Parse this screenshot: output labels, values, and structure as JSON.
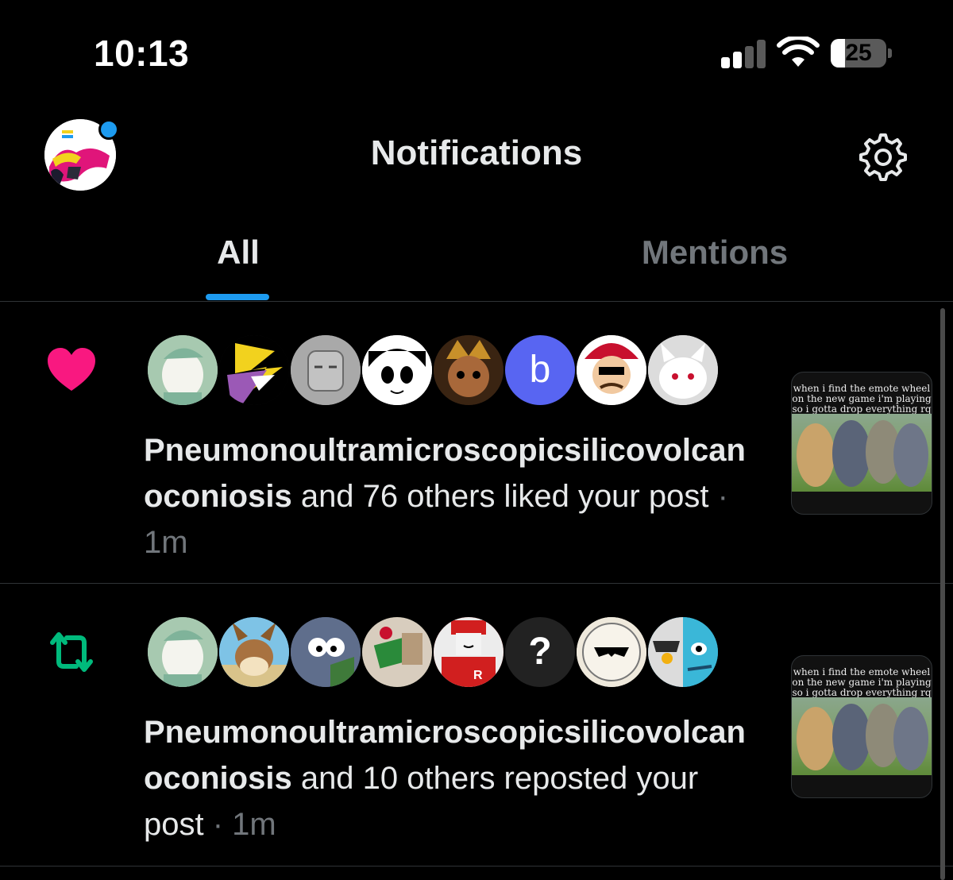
{
  "status_bar": {
    "time": "10:13",
    "battery_level": "25",
    "battery_fraction": 0.25
  },
  "header": {
    "title": "Notifications",
    "settings_icon": "gear-icon",
    "has_unread_dot": true
  },
  "tabs": [
    {
      "label": "All",
      "active": true
    },
    {
      "label": "Mentions",
      "active": false
    }
  ],
  "notifications": [
    {
      "type": "like",
      "icon": "heart-icon",
      "icon_color": "#f91880",
      "user": "Pneumonoultramicroscopicsilicovolcanoconiosis",
      "action": " and 76 others liked your post",
      "separator": " · ",
      "time": "1m",
      "thumbnail_caption": "when i find the emote wheel on the new game i'm playing so i gotta drop everything rq",
      "avatars": [
        {
          "color": "#a7c9b0"
        },
        {
          "color": "#f2d21e"
        },
        {
          "color": "#9a9a9a"
        },
        {
          "color": "#ffffff"
        },
        {
          "color": "#7a4a2a"
        },
        {
          "color": "#5865f2",
          "letter": "b"
        },
        {
          "color": "#c8102e"
        },
        {
          "color": "#eaeaea"
        }
      ]
    },
    {
      "type": "repost",
      "icon": "repost-icon",
      "icon_color": "#00ba7c",
      "user": "Pneumonoultramicroscopicsilicovolcanoconiosis",
      "action": " and 10 others reposted your post",
      "separator": " · ",
      "time": "1m",
      "thumbnail_caption": "when i find the emote wheel on the new game i'm playing so i gotta drop everything rq",
      "avatars": [
        {
          "color": "#a7c9b0"
        },
        {
          "color": "#5aa7d6"
        },
        {
          "color": "#5f6e8c"
        },
        {
          "color": "#3a4a2e"
        },
        {
          "color": "#d11f1f"
        },
        {
          "color": "#222222",
          "letter": "?"
        },
        {
          "color": "#efe9dc"
        },
        {
          "color": "#3ab7d8"
        }
      ]
    }
  ]
}
